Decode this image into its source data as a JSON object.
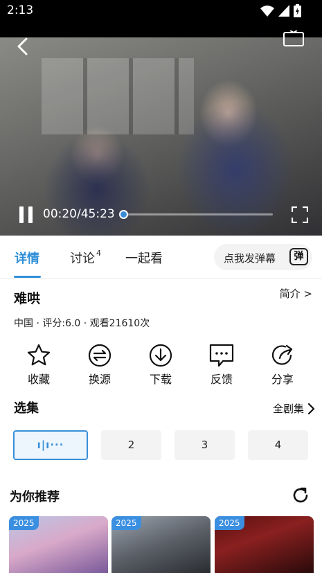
{
  "status_bar": {
    "time": "2:13"
  },
  "player": {
    "time_text": "00:20/45:23",
    "progress_fraction": 0.0074,
    "tv_icon_label": "TV"
  },
  "tabs": [
    {
      "label": "详情",
      "badge": ""
    },
    {
      "label": "讨论",
      "badge": "4"
    },
    {
      "label": "一起看",
      "badge": ""
    }
  ],
  "danmaku": {
    "label": "点我发弹幕",
    "icon_text": "弹"
  },
  "info": {
    "title": "难哄",
    "intro_link": "简介 >",
    "meta": "中国 · 评分:6.0 · 观看21610次"
  },
  "actions": [
    {
      "label": "收藏",
      "icon": "star-icon"
    },
    {
      "label": "换源",
      "icon": "switch-source-icon"
    },
    {
      "label": "下载",
      "icon": "download-icon"
    },
    {
      "label": "反馈",
      "icon": "feedback-icon"
    },
    {
      "label": "分享",
      "icon": "share-icon"
    }
  ],
  "episodes": {
    "section_title": "选集",
    "all_label": "全剧集",
    "playing_indicator": "ı|ı···",
    "items": [
      "2",
      "3",
      "4"
    ]
  },
  "recommend": {
    "section_title": "为你推荐",
    "cards": [
      {
        "year": "2025"
      },
      {
        "year": "2025"
      },
      {
        "year": "2025"
      }
    ]
  },
  "colors": {
    "accent": "#2f8fd8",
    "badge": "#3b8fe0",
    "chip_bg": "#f3f3f3"
  }
}
